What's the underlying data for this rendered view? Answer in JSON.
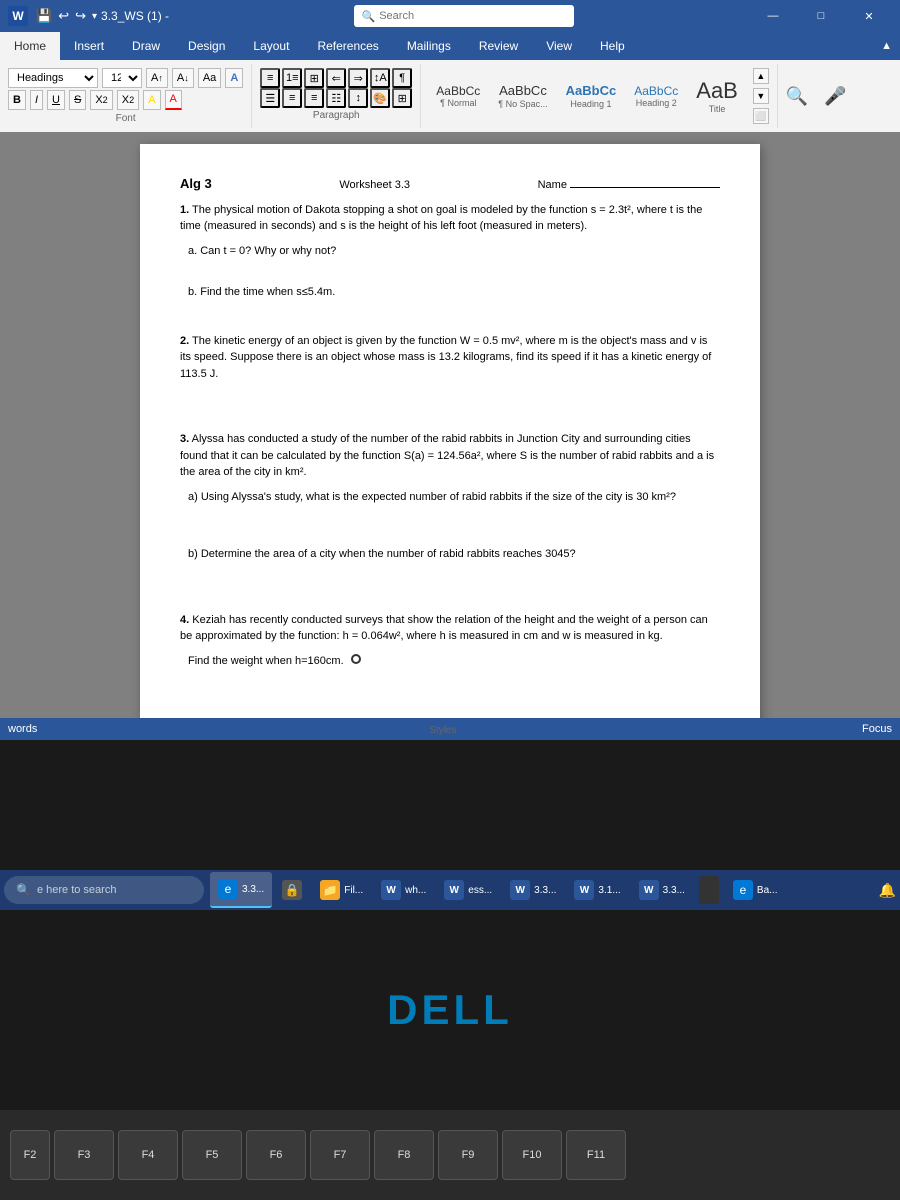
{
  "titlebar": {
    "undo_icon": "↩",
    "redo_icon": "↪",
    "save_icon": "💾",
    "title": "3.3_WS (1) -",
    "search_placeholder": "Search",
    "minimize": "—",
    "maximize": "□",
    "close": "✕",
    "ribbon_icon": "▲"
  },
  "ribbon": {
    "tabs": [
      "Insert",
      "Draw",
      "Design",
      "Layout",
      "References",
      "Mailings",
      "Review",
      "View",
      "Help"
    ],
    "active_tab": "Home",
    "font_name": "Headings",
    "font_size": "12",
    "font_buttons": [
      "A▲",
      "A▼",
      "Aa▾",
      "A"
    ],
    "paragraph_label": "Paragraph",
    "font_label": "Font",
    "styles_label": "Styles",
    "styles": [
      {
        "name": "¶ Normal",
        "label": "Normal",
        "class": "normal"
      },
      {
        "name": "¶ No Spac...",
        "label": "No Spac...",
        "class": "nospace"
      },
      {
        "name": "Heading 1",
        "label": "Heading 1",
        "class": "heading1"
      },
      {
        "name": "Heading 2",
        "label": "Heading 2",
        "class": "heading2"
      },
      {
        "name": "AaB",
        "label": "Title",
        "class": "big-title"
      }
    ]
  },
  "document": {
    "heading": "Alg 3",
    "worksheet_title": "Worksheet 3.3",
    "name_label": "Name",
    "problem1": {
      "number": "1.",
      "text": "The physical motion of Dakota stopping a shot on goal is modeled by the function s = 2.3t², where t is the time (measured in seconds) and s is the height of his left foot (measured in meters).",
      "sub_a": "a. Can t = 0? Why or why not?",
      "sub_b": "b. Find the time when s≤5.4m."
    },
    "problem2": {
      "number": "2.",
      "text": "The kinetic energy of an object is given by the function W = 0.5 mv², where m is the object's mass and v is its speed. Suppose there is an object whose mass is 13.2 kilograms, find its speed if it has a kinetic energy of 113.5 J."
    },
    "problem3": {
      "number": "3.",
      "text": "Alyssa has conducted a study of the number of the rabid rabbits in Junction City and surrounding cities found that it can be calculated by the function S(a) = 124.56a², where S is the number of rabid rabbits and a is the area of the city in km².",
      "sub_a": "a) Using Alyssa's study, what is the expected number of rabid rabbits if the size of the city is 30 km²?",
      "sub_b": "b) Determine the area of a city when the number of rabid rabbits reaches 3045?"
    },
    "problem4": {
      "number": "4.",
      "text": "Keziah has recently conducted surveys that show the relation of the height and the weight of a person can be approximated by the function: h = 0.064w², where h is measured in cm and w is measured in kg.",
      "sub_a": "Find the weight when h=160cm."
    }
  },
  "statusbar": {
    "words_label": "words",
    "focus_label": "Focus"
  },
  "taskbar": {
    "search_placeholder": "e here to search",
    "items": [
      {
        "label": "3.3...",
        "type": "edge",
        "icon": "e",
        "active": true
      },
      {
        "label": "",
        "type": "lock",
        "icon": "🔒"
      },
      {
        "label": "Fil...",
        "type": "file",
        "icon": "📁"
      },
      {
        "label": "W wh...",
        "type": "word",
        "icon": "W"
      },
      {
        "label": "W ess...",
        "type": "word",
        "icon": "W"
      },
      {
        "label": "W 3.3...",
        "type": "word",
        "icon": "W"
      },
      {
        "label": "W 3.1...",
        "type": "word",
        "icon": "W"
      },
      {
        "label": "W 3.3...",
        "type": "word",
        "icon": "W"
      },
      {
        "label": "Ba...",
        "type": "edge",
        "icon": "e"
      }
    ]
  },
  "dell_logo": "DELL",
  "keyboard": {
    "keys": [
      "F2",
      "F3",
      "F4",
      "F5",
      "F6",
      "F7",
      "F8",
      "F9",
      "F10",
      "F11"
    ]
  }
}
